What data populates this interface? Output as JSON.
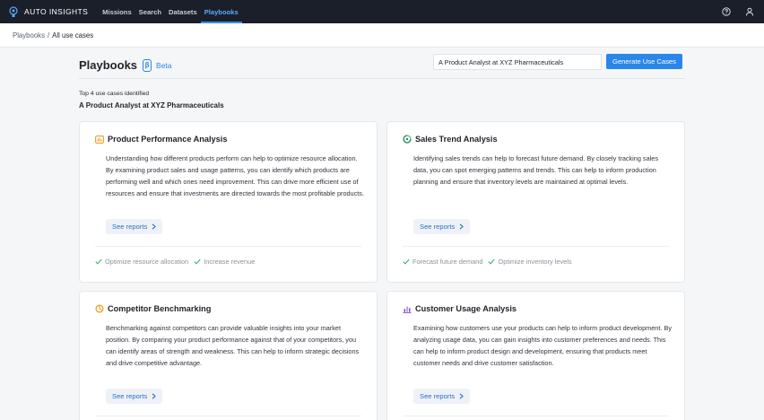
{
  "nav": {
    "brand": "AUTO INSIGHTS",
    "items": [
      {
        "label": "Missions",
        "active": false
      },
      {
        "label": "Search",
        "active": false
      },
      {
        "label": "Datasets",
        "active": false
      },
      {
        "label": "Playbooks",
        "active": true
      }
    ],
    "accent": "#3b8eea",
    "background": "#1b1f2a",
    "right_icons": [
      "help-icon",
      "user-icon"
    ]
  },
  "breadcrumb": {
    "parent": "Playbooks",
    "separator": "/",
    "current": "All use cases"
  },
  "header": {
    "title": "Playbooks",
    "beta_icon": "β",
    "beta_label": "Beta",
    "search_value": "A Product Analyst at XYZ Pharmaceuticals",
    "generate_label": "Generate Use Cases"
  },
  "summary": {
    "count_text": "Top 4 use cases identified",
    "role": "A Product Analyst at XYZ Pharmaceuticals"
  },
  "cards": [
    {
      "title": "Product Performance Analysis",
      "icon": "chart-box-icon",
      "icon_color": "#f0a020",
      "description": "Understanding how different products perform can help to optimize resource allocation. By examining product sales and usage patterns, you can identify which products are performing well and which ones need improvement. This can drive more efficient use of resources and ensure that investments are directed towards the most profitable products.",
      "reports_label": "See reports",
      "tags": [
        "Optimize resource allocation",
        "Increase revenue"
      ]
    },
    {
      "title": "Sales Trend Analysis",
      "icon": "trend-ring-icon",
      "icon_color": "#1f8f5f",
      "description": "Identifying sales trends can help to forecast future demand. By closely tracking sales data, you can spot emerging patterns and trends. This can help to inform production planning and ensure that inventory levels are maintained at optimal levels.",
      "reports_label": "See reports",
      "tags": [
        "Forecast future demand",
        "Optimize inventory levels"
      ]
    },
    {
      "title": "Competitor Benchmarking",
      "icon": "pie-clock-icon",
      "icon_color": "#f0a020",
      "description": "Benchmarking against competitors can provide valuable insights into your market position. By comparing your product performance against that of your competitors, you can identify areas of strength and weakness. This can help to inform strategic decisions and drive competitive advantage.",
      "reports_label": "See reports",
      "tags": []
    },
    {
      "title": "Customer Usage Analysis",
      "icon": "bar-chart-icon",
      "icon_color": "#8a4fd8",
      "description": "Examining how customers use your products can help to inform product development. By analyzing usage data, you can gain insights into customer preferences and needs. This can help to inform product design and development, ensuring that products meet customer needs and drive customer satisfaction.",
      "reports_label": "See reports",
      "tags": []
    }
  ]
}
